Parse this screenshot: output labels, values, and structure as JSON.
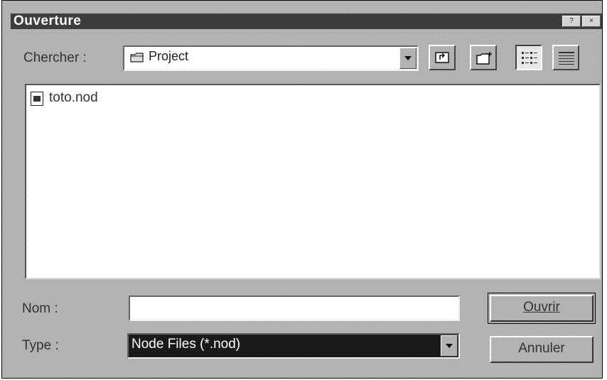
{
  "window": {
    "title": "Ouverture",
    "help_button": "?",
    "close_button": "×"
  },
  "lookin": {
    "label": "Chercher :",
    "value": "Project"
  },
  "toolbar": {
    "up_folder": "up-folder",
    "new_folder": "new-folder",
    "list_view": "list-view",
    "details_view": "details-view"
  },
  "files": [
    {
      "name": "toto.nod",
      "icon": "node-file-icon"
    }
  ],
  "filename": {
    "label": "Nom :",
    "value": ""
  },
  "filetype": {
    "label": "Type :",
    "value": "Node Files (*.nod)"
  },
  "buttons": {
    "open": "Ouvrir",
    "cancel": "Annuler"
  },
  "colors": {
    "titlebar": "#2a2a2a",
    "face": "#c8c8c8",
    "selected": "#1a1a1a"
  }
}
